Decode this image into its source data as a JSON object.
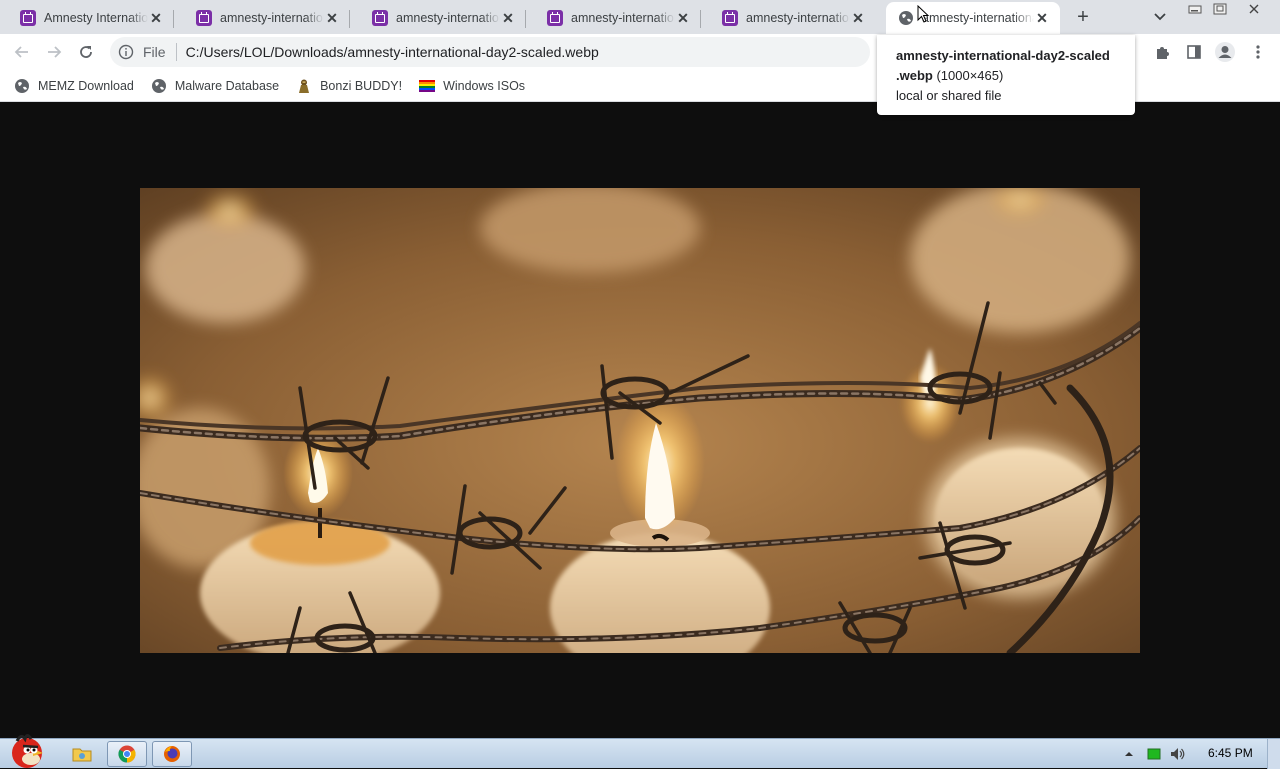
{
  "browser": {
    "tabs": [
      {
        "title": "Amnesty Internationa",
        "icon": "calendar-favicon",
        "active": false
      },
      {
        "title": "amnesty-international",
        "icon": "calendar-favicon",
        "active": false
      },
      {
        "title": "amnesty-international",
        "icon": "calendar-favicon",
        "active": false
      },
      {
        "title": "amnesty-international",
        "icon": "calendar-favicon",
        "active": false
      },
      {
        "title": "amnesty-international",
        "icon": "calendar-favicon",
        "active": false
      },
      {
        "title": "amnesty-international",
        "icon": "globe-favicon",
        "active": true
      }
    ],
    "new_tab_label": "+",
    "address": {
      "scheme": "File",
      "url": "C:/Users/LOL/Downloads/amnesty-international-day2-scaled.webp"
    },
    "bookmarks": [
      {
        "label": "MEMZ Download",
        "icon": "globe-icon"
      },
      {
        "label": "Malware Database",
        "icon": "globe-icon"
      },
      {
        "label": "Bonzi BUDDY!",
        "icon": "bonzi-icon"
      },
      {
        "label": "Windows ISOs",
        "icon": "windows-flag-icon"
      }
    ],
    "tooltip": {
      "filename_line1": "amnesty-international-day2-scaled",
      "filename_line2": ".webp",
      "dimensions": "(1000×465)",
      "type": "local or shared file"
    }
  },
  "image": {
    "subject": "lit candles encircled by barbed wire"
  },
  "taskbar": {
    "clock": "6:45 PM",
    "apps": [
      "angry-birds-start-icon",
      "explorer-icon",
      "chrome-icon",
      "firefox-icon"
    ]
  },
  "colors": {
    "tab_favicon": "#7b2fa7",
    "tabstrip_bg": "#dee1e6",
    "viewer_bg": "#0e0e0e"
  }
}
